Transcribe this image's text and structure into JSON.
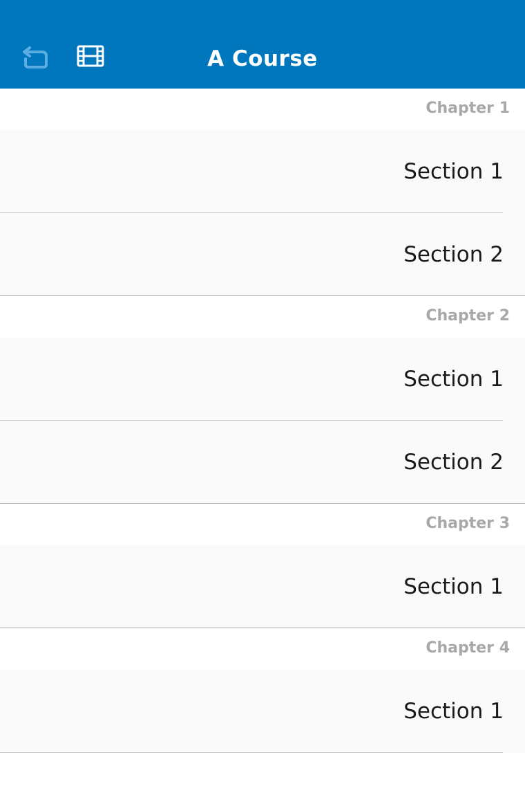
{
  "navbar": {
    "title": "A Course",
    "background_color": "#0077bd",
    "back_icon": "undo-arrow-icon",
    "video_icon": "film-strip-icon"
  },
  "chapters": [
    {
      "label": "Chapter 1",
      "sections": [
        "Section 1",
        "Section 2"
      ]
    },
    {
      "label": "Chapter 2",
      "sections": [
        "Section 1",
        "Section 2"
      ]
    },
    {
      "label": "Chapter 3",
      "sections": [
        "Section 1"
      ]
    },
    {
      "label": "Chapter 4",
      "sections": [
        "Section 1"
      ]
    }
  ]
}
